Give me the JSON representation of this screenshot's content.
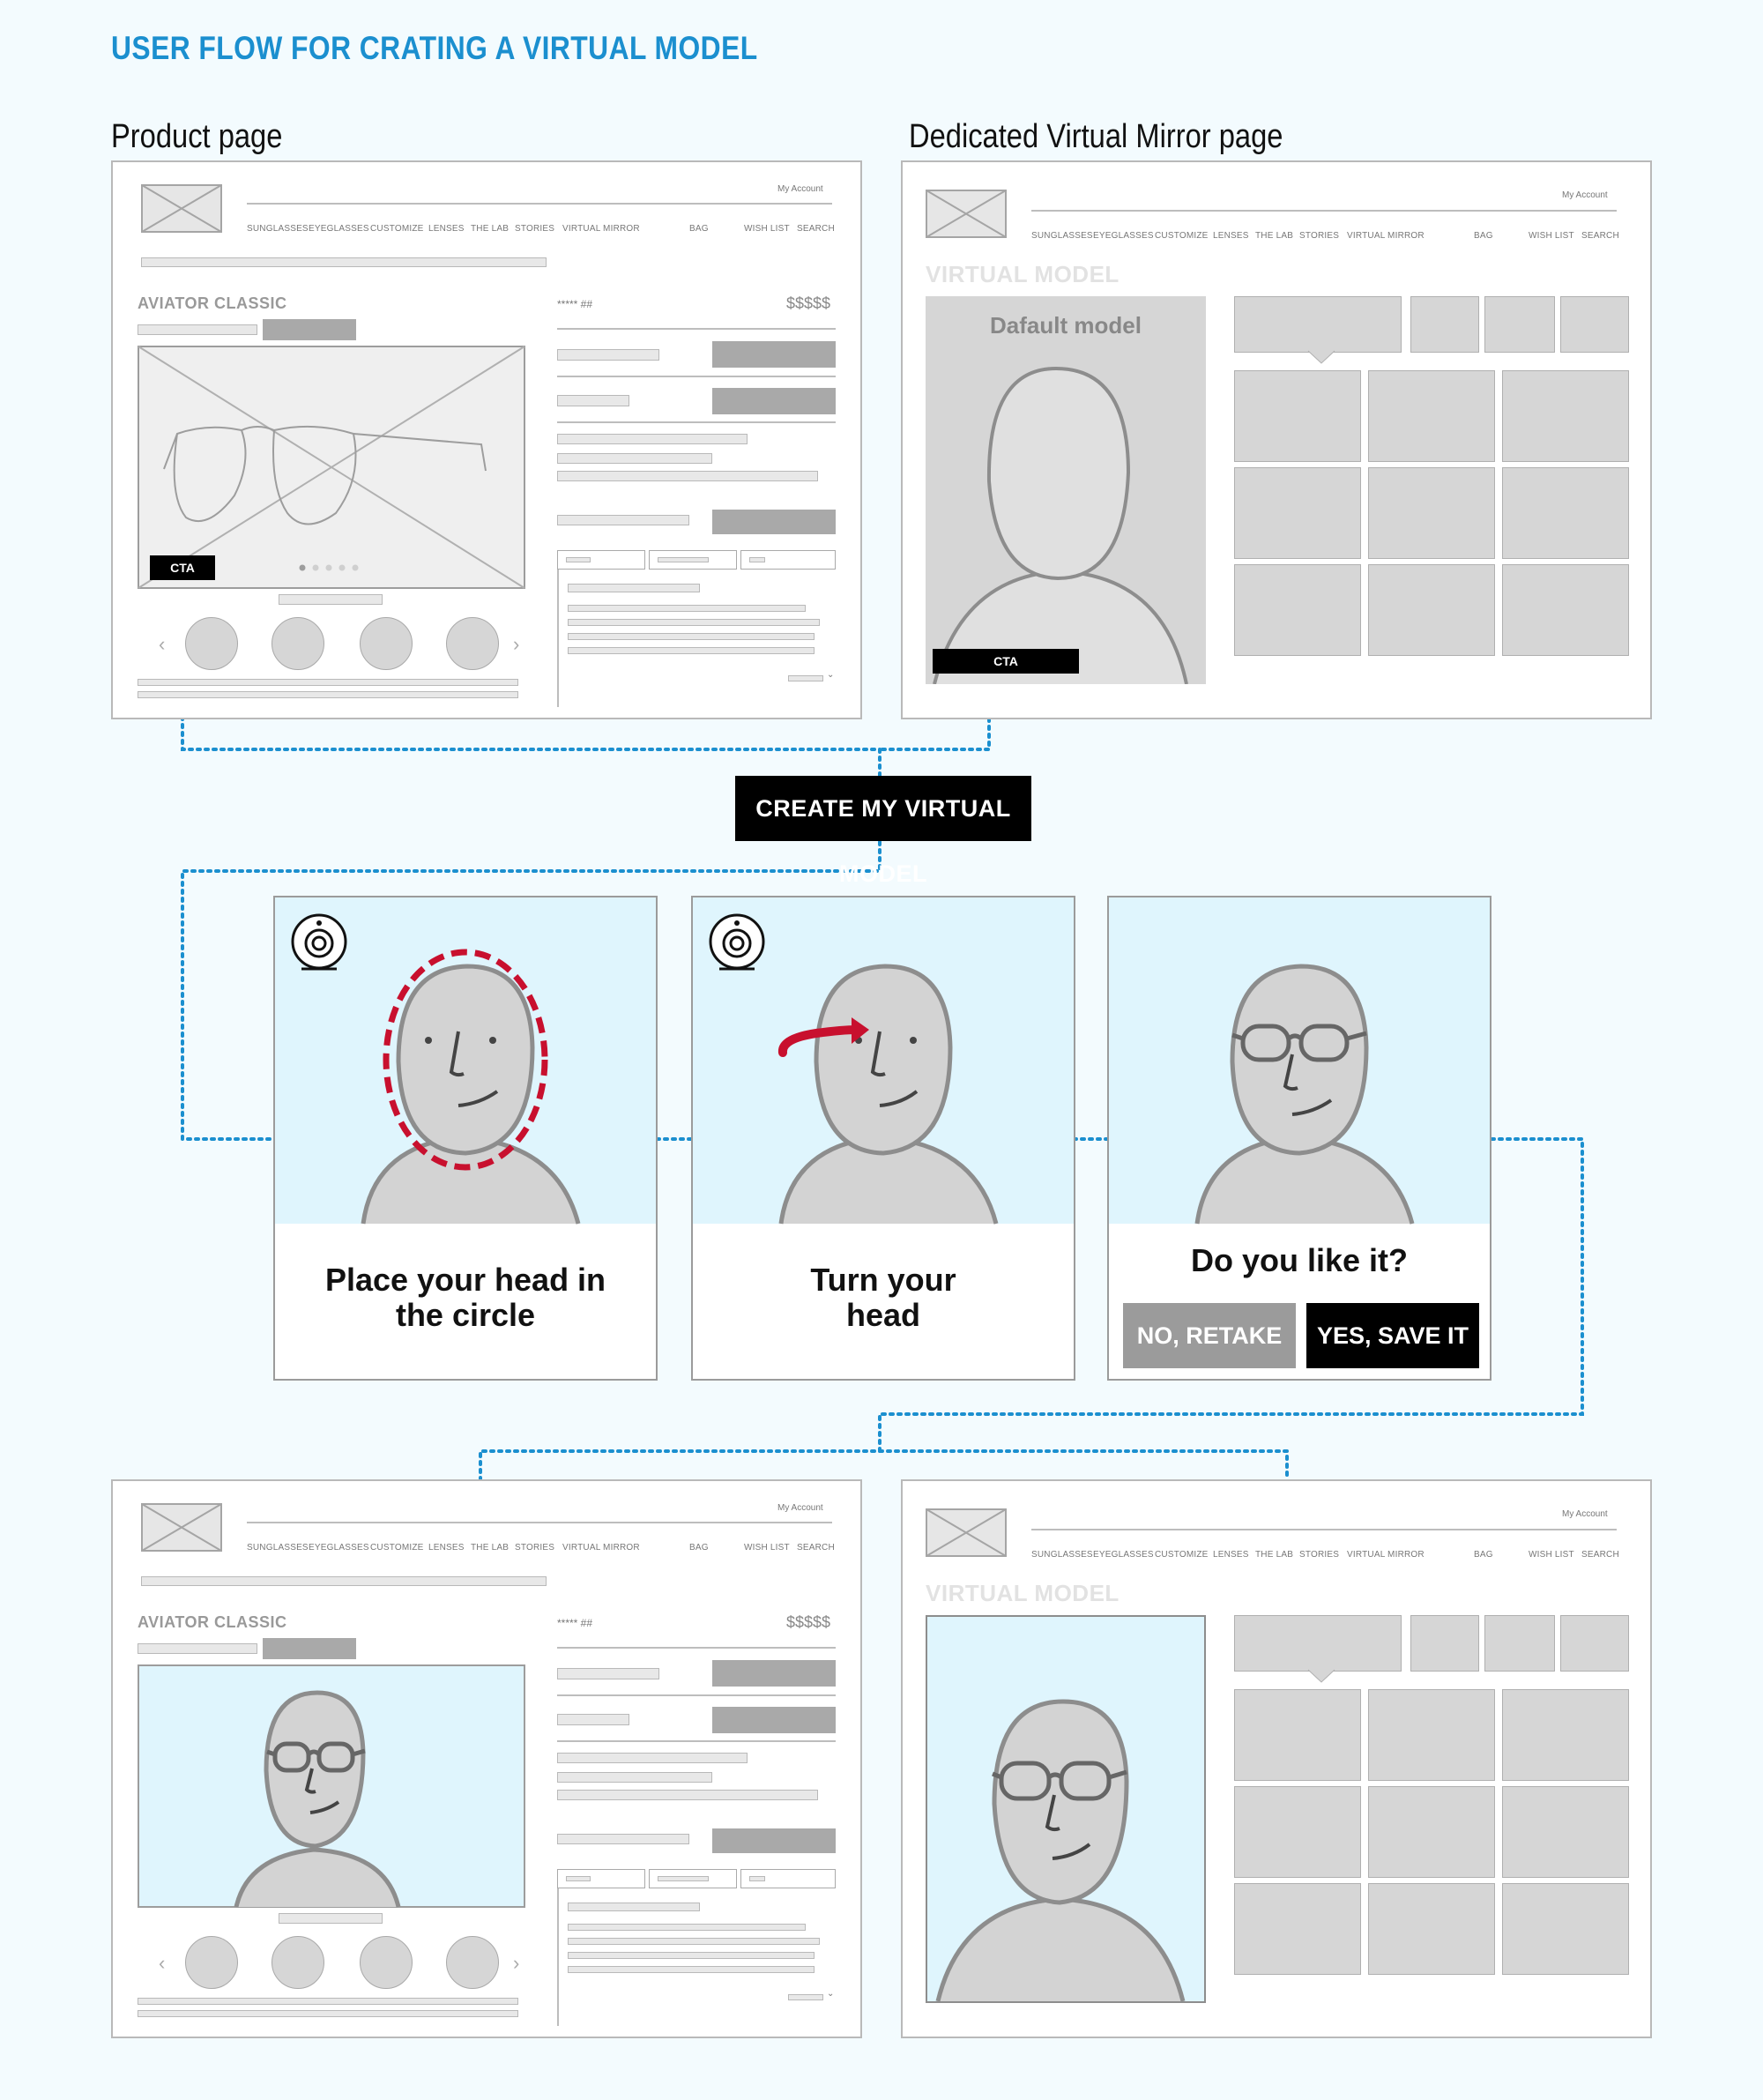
{
  "title": "USER FLOW FOR CRATING A VIRTUAL MODEL",
  "labels": {
    "product_page": "Product page",
    "mirror_page": "Dedicated Virtual Mirror page"
  },
  "nav": {
    "my_account": "My Account",
    "items": [
      "SUNGLASSES",
      "EYEGLASSES",
      "CUSTOMIZE",
      "LENSES",
      "THE LAB",
      "STORIES",
      "VIRTUAL MIRROR"
    ],
    "bag": "BAG",
    "wish_list": "WISH LIST",
    "search": "SEARCH"
  },
  "product": {
    "name": "AVIATOR CLASSIC",
    "rating": "***** ##",
    "price": "$$$$$",
    "cta": "CTA"
  },
  "mirror": {
    "heading": "VIRTUAL MODEL",
    "default_model": "Dafault model",
    "cta": "CTA"
  },
  "main_cta": "CREATE MY VIRTUAL MODEL",
  "steps": {
    "step1": [
      "Place your head in",
      "the circle"
    ],
    "step2": [
      "Turn your",
      "head"
    ],
    "step3_question": "Do you like it?",
    "retake": "NO, RETAKE",
    "save": "YES, SAVE IT"
  },
  "colors": {
    "title": "#1b8fcf",
    "connector": "#1b8fcf",
    "face_guide": "#c8102e",
    "panel_bg": "#dff5fd"
  }
}
